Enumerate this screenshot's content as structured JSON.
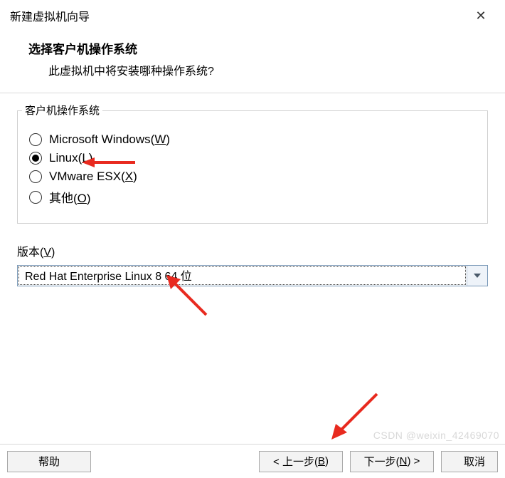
{
  "window": {
    "title": "新建虚拟机向导"
  },
  "header": {
    "title": "选择客户机操作系统",
    "subtitle": "此虚拟机中将安装哪种操作系统?"
  },
  "os_group": {
    "legend": "客户机操作系统",
    "options": [
      {
        "label": "Microsoft Windows(",
        "mn": "W",
        "tail": ")",
        "checked": false
      },
      {
        "label": "Linux(",
        "mn": "L",
        "tail": ")",
        "checked": true
      },
      {
        "label": "VMware ESX(",
        "mn": "X",
        "tail": ")",
        "checked": false
      },
      {
        "label": "其他(",
        "mn": "O",
        "tail": ")",
        "checked": false
      }
    ]
  },
  "version": {
    "label_pre": "版本(",
    "label_mn": "V",
    "label_post": ")",
    "selected": "Red Hat Enterprise Linux 8 64 位"
  },
  "footer": {
    "help": "帮助",
    "back_pre": "< 上一步(",
    "back_mn": "B",
    "back_post": ")",
    "next_pre": "下一步(",
    "next_mn": "N",
    "next_post": ") >",
    "cancel": "取消"
  },
  "watermark": "CSDN @weixin_42469070"
}
